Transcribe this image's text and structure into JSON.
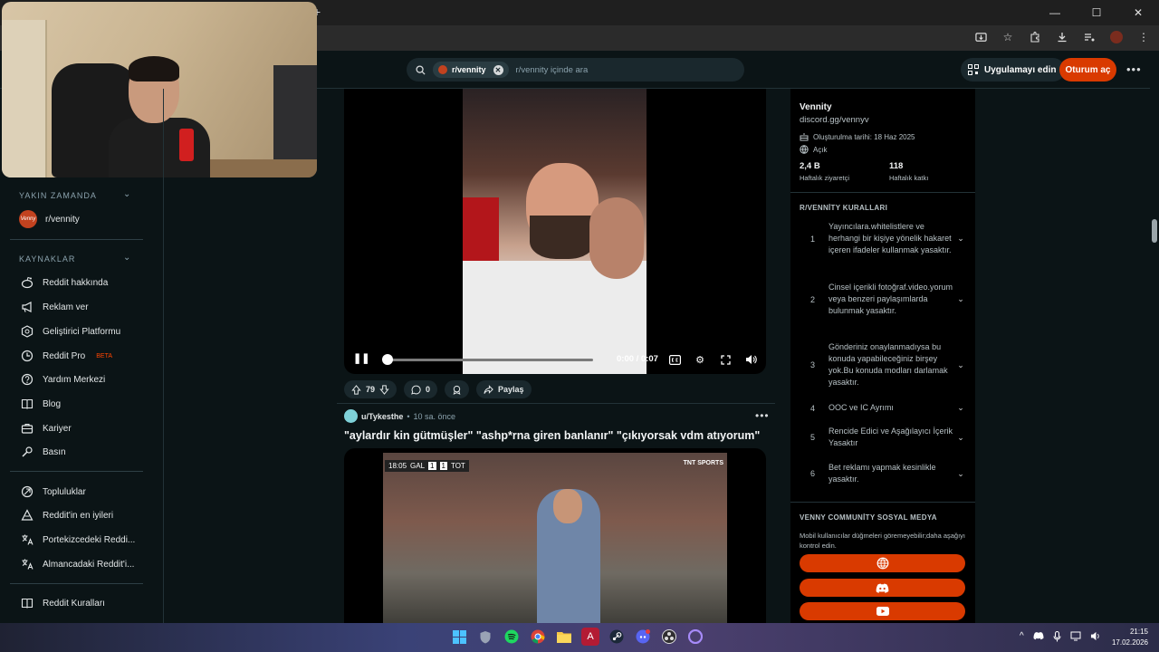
{
  "browser": {
    "new_tab_glyph": "+",
    "window_controls": [
      "—",
      "☐",
      "✕"
    ]
  },
  "header": {
    "subreddit_chip": "r/vennity",
    "search_placeholder": "r/vennity içinde ara",
    "get_app_label": "Uygulamayı edin",
    "login_label": "Oturum aç"
  },
  "sidebar": {
    "recent_title": "YAKIN ZAMANDA",
    "recent_items": [
      {
        "label": "r/vennity",
        "avatar_text": "Venny"
      }
    ],
    "resources_title": "KAYNAKLAR",
    "resources": [
      {
        "label": "Reddit hakkında",
        "icon": "reddit-icon"
      },
      {
        "label": "Reklam ver",
        "icon": "megaphone-icon"
      },
      {
        "label": "Geliştirici Platformu",
        "icon": "developer-icon"
      },
      {
        "label": "Reddit Pro",
        "icon": "pro-icon",
        "badge": "BETA"
      },
      {
        "label": "Yardım Merkezi",
        "icon": "help-icon"
      },
      {
        "label": "Blog",
        "icon": "book-icon"
      },
      {
        "label": "Kariyer",
        "icon": "briefcase-icon"
      },
      {
        "label": "Basın",
        "icon": "microphone-icon"
      }
    ],
    "community_items": [
      {
        "label": "Topluluklar",
        "icon": "communities-icon"
      },
      {
        "label": "Reddit'in en iyileri",
        "icon": "best-of-icon"
      },
      {
        "label": "Portekizcedeki Reddi...",
        "icon": "translate-icon"
      },
      {
        "label": "Almancadaki Reddit'i...",
        "icon": "translate-icon"
      }
    ],
    "rules_link": {
      "label": "Reddit Kuralları",
      "icon": "rules-icon"
    }
  },
  "video_post": {
    "time": "0:00 / 0:07",
    "progress": 0,
    "votes": "79",
    "comments": "0",
    "share_label": "Paylaş"
  },
  "next_post": {
    "author": "u/Tykesthe",
    "time_ago": "10 sa. önce",
    "title": "\"aylardır kin gütmüşler\" \"ashp*rna giren banlanır\" \"çıkıyorsak vdm atıyorum\"",
    "scorebug": {
      "time": "18:05",
      "home": "GAL",
      "home_score": "1",
      "away_score": "1",
      "away": "TOT",
      "channel": "TNT SPORTS"
    }
  },
  "community": {
    "name": "Vennity",
    "link": "discord.gg/vennyv",
    "created": "Oluşturulma tarihi: 18 Haz 2025",
    "visibility": "Açık",
    "weekly_visitors_value": "2,4 B",
    "weekly_visitors_label": "Haftalık ziyaretçi",
    "weekly_contrib_value": "118",
    "weekly_contrib_label": "Haftalık katkı",
    "rules_title": "R/VENNİTY KURALLARI",
    "rules": [
      {
        "num": "1",
        "text": "Yayıncılara.whitelistlere ve herhangi bir kişiye yönelik hakaret içeren ifadeler kullanmak yasaktır."
      },
      {
        "num": "2",
        "text": "Cinsel içerikli fotoğraf.video.yorum veya benzeri paylaşımlarda bulunmak yasaktır."
      },
      {
        "num": "3",
        "text": "Gönderiniz onaylanmadıysa bu konuda yapabileceğiniz birşey yok.Bu konuda modları darlamak yasaktır."
      },
      {
        "num": "4",
        "text": "OOC ve IC Ayrımı"
      },
      {
        "num": "5",
        "text": "Rencide Edici ve Aşağılayıcı İçerik Yasaktır"
      },
      {
        "num": "6",
        "text": "Bet reklamı yapmak kesinlikle yasaktır."
      }
    ],
    "social_title": "VENNY COMMUNİTY SOSYAL MEDYA",
    "social_desc": "Mobil kullanıcılar düğmeleri göremeyebilir;daha aşağıyı kontrol edin.",
    "social_buttons": [
      "globe-icon",
      "discord-icon",
      "youtube-icon"
    ]
  },
  "taskbar": {
    "time": "21:15",
    "date": "17.02.2026"
  },
  "colors": {
    "accent": "#d93a00",
    "background": "#0b1416"
  }
}
